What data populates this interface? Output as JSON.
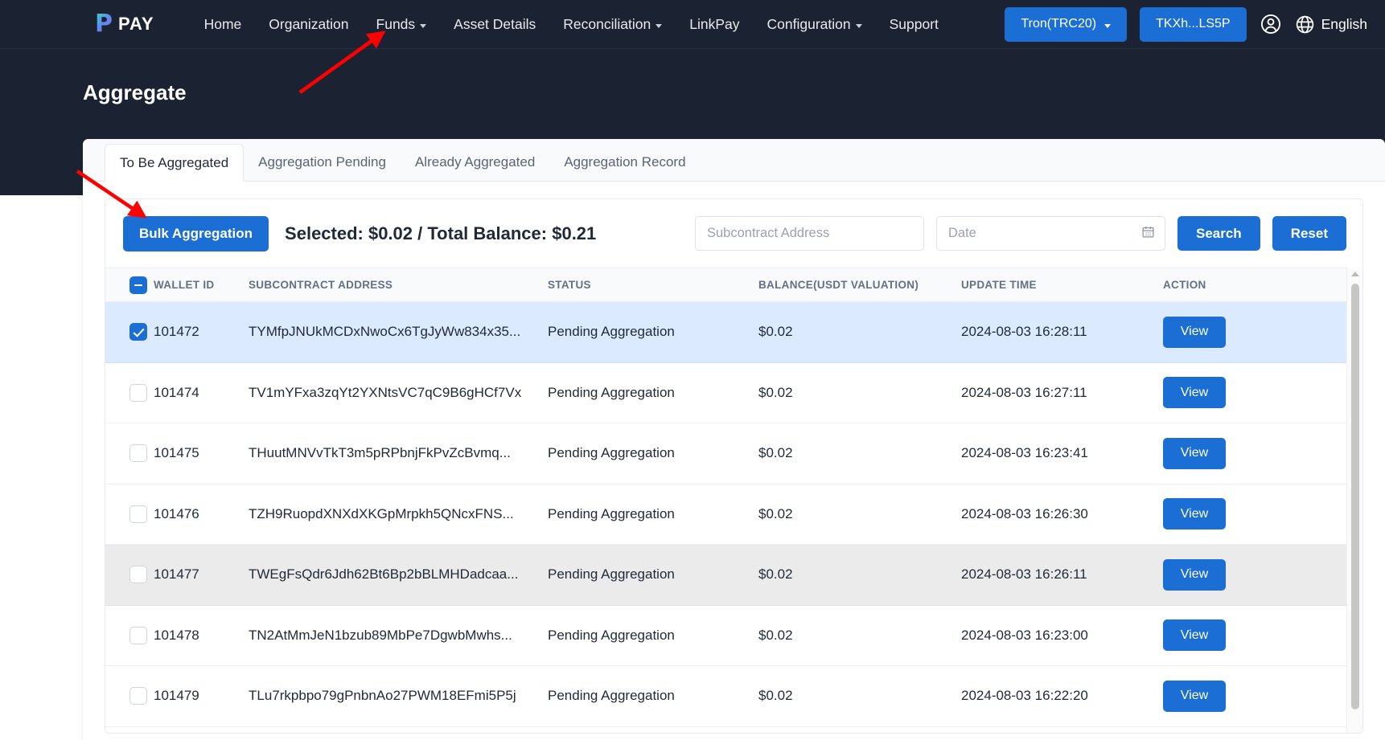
{
  "navbar": {
    "logo_mark": "P",
    "logo_text": "PAY",
    "items": [
      {
        "label": "Home",
        "has_caret": false
      },
      {
        "label": "Organization",
        "has_caret": false
      },
      {
        "label": "Funds",
        "has_caret": true
      },
      {
        "label": "Asset Details",
        "has_caret": false
      },
      {
        "label": "Reconciliation",
        "has_caret": true
      },
      {
        "label": "LinkPay",
        "has_caret": false
      },
      {
        "label": "Configuration",
        "has_caret": true
      },
      {
        "label": "Support",
        "has_caret": false
      }
    ],
    "network_button": "Tron(TRC20)",
    "wallet_button": "TKXh...LS5P",
    "account_icon": "user-circle-icon",
    "globe_icon": "globe-icon",
    "language": "English"
  },
  "page": {
    "title": "Aggregate"
  },
  "tabs": [
    {
      "label": "To Be Aggregated",
      "active": true
    },
    {
      "label": "Aggregation Pending",
      "active": false
    },
    {
      "label": "Already Aggregated",
      "active": false
    },
    {
      "label": "Aggregation Record",
      "active": false
    }
  ],
  "toolbar": {
    "bulk_button": "Bulk Aggregation",
    "summary": "Selected: $0.02 / Total Balance: $0.21",
    "address_placeholder": "Subcontract Address",
    "address_value": "",
    "date_placeholder": "Date",
    "date_value": "",
    "calendar_icon": "calendar-icon",
    "search_button": "Search",
    "reset_button": "Reset"
  },
  "table": {
    "select_all_state": "indeterminate",
    "columns": [
      "WALLET ID",
      "SUBCONTRACT ADDRESS",
      "STATUS",
      "BALANCE(USDT VALUATION)",
      "UPDATE TIME",
      "ACTION"
    ],
    "action_label": "View",
    "rows": [
      {
        "checked": true,
        "state": "selected",
        "wallet_id": "101472",
        "address": "TYMfpJNUkMCDxNwoCx6TgJyWw834x35...",
        "status": "Pending Aggregation",
        "balance": "$0.02",
        "update_time": "2024-08-03 16:28:11"
      },
      {
        "checked": false,
        "state": "normal",
        "wallet_id": "101474",
        "address": "TV1mYFxa3zqYt2YXNtsVC7qC9B6gHCf7Vx",
        "status": "Pending Aggregation",
        "balance": "$0.02",
        "update_time": "2024-08-03 16:27:11"
      },
      {
        "checked": false,
        "state": "normal",
        "wallet_id": "101475",
        "address": "THuutMNVvTkT3m5pRPbnjFkPvZcBvmq...",
        "status": "Pending Aggregation",
        "balance": "$0.02",
        "update_time": "2024-08-03 16:23:41"
      },
      {
        "checked": false,
        "state": "normal",
        "wallet_id": "101476",
        "address": "TZH9RuopdXNXdXKGpMrpkh5QNcxFNS...",
        "status": "Pending Aggregation",
        "balance": "$0.02",
        "update_time": "2024-08-03 16:26:30"
      },
      {
        "checked": false,
        "state": "hovered",
        "wallet_id": "101477",
        "address": "TWEgFsQdr6Jdh62Bt6Bp2bBLMHDadcaa...",
        "status": "Pending Aggregation",
        "balance": "$0.02",
        "update_time": "2024-08-03 16:26:11"
      },
      {
        "checked": false,
        "state": "normal",
        "wallet_id": "101478",
        "address": "TN2AtMmJeN1bzub89MbPe7DgwbMwhs...",
        "status": "Pending Aggregation",
        "balance": "$0.02",
        "update_time": "2024-08-03 16:23:00"
      },
      {
        "checked": false,
        "state": "normal",
        "wallet_id": "101479",
        "address": "TLu7rkpbpo79gPnbnAo27PWM18EFmi5P5j",
        "status": "Pending Aggregation",
        "balance": "$0.02",
        "update_time": "2024-08-03 16:22:20"
      }
    ]
  },
  "annotations": [
    {
      "name": "arrow-to-funds-menu",
      "color": "#ff0000"
    },
    {
      "name": "arrow-to-bulk-aggregation",
      "color": "#ff0000"
    }
  ],
  "colors": {
    "header_bg": "#1b2332",
    "accent": "#1b6fd4",
    "selected_row": "#dbeafe",
    "hover_row": "#ebebeb",
    "annotation": "#ff0000"
  }
}
